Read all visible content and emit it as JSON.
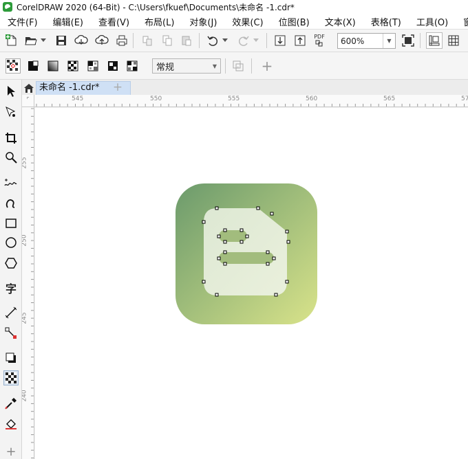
{
  "window": {
    "title": "CorelDRAW 2020 (64-Bit) - C:\\Users\\fkuef\\Documents\\未命名 -1.cdr*"
  },
  "menu": [
    "文件(F)",
    "编辑(E)",
    "查看(V)",
    "布局(L)",
    "对象(J)",
    "效果(C)",
    "位图(B)",
    "文本(X)",
    "表格(T)",
    "工具(O)",
    "窗口"
  ],
  "toolbar": {
    "zoom_value": "600%",
    "pdf_label": "PDF"
  },
  "property_bar": {
    "style_value": "常规"
  },
  "toolbox": {
    "text_tool_glyph": "字"
  },
  "tabs": {
    "document": "未命名 -1.cdr*",
    "add": "+"
  },
  "rulers": {
    "horizontal": [
      "545",
      "550",
      "555",
      "560",
      "565",
      "57"
    ],
    "vertical": [
      "255",
      "250",
      "245",
      "240"
    ]
  },
  "colors": {
    "gradient_start": "#6b9a6c",
    "gradient_end": "#d9e38a",
    "inner_shape": "#e6eed8",
    "bar_fill": "#a2bc7d",
    "accent_selection": "#cfe0f5"
  }
}
